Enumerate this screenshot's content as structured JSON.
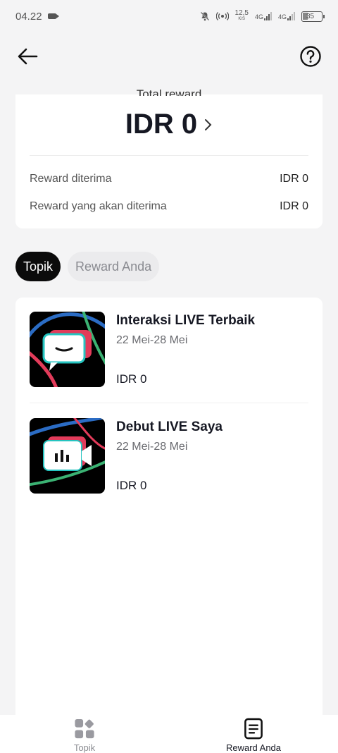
{
  "status_bar": {
    "time": "04.22",
    "speed_value": "12,5",
    "speed_unit": "K/S",
    "net1": "4G",
    "net2": "4G",
    "battery": "35"
  },
  "summary": {
    "label": "Total reward",
    "total": "IDR 0",
    "rows": [
      {
        "label": "Reward diterima",
        "value": "IDR 0"
      },
      {
        "label": "Reward yang akan diterima",
        "value": "IDR 0"
      }
    ]
  },
  "tabs": [
    {
      "label": "Topik",
      "active": true
    },
    {
      "label": "Reward Anda",
      "active": false
    }
  ],
  "topics": [
    {
      "title": "Interaksi LIVE Terbaik",
      "date": "22 Mei-28 Mei",
      "amount": "IDR 0",
      "icon": "live-interaction-icon"
    },
    {
      "title": "Debut LIVE Saya",
      "date": "22 Mei-28 Mei",
      "amount": "IDR 0",
      "icon": "live-debut-icon"
    }
  ],
  "bottom_nav": [
    {
      "label": "Topik",
      "icon": "topics-grid-icon",
      "active": false
    },
    {
      "label": "Reward Anda",
      "icon": "rewards-document-icon",
      "active": true
    }
  ],
  "colors": {
    "background": "#f4f4f5",
    "card": "#ffffff",
    "text": "#161823",
    "accent_red": "#fe2c55",
    "accent_cyan": "#25f4ee",
    "accent_green": "#3bb273"
  }
}
